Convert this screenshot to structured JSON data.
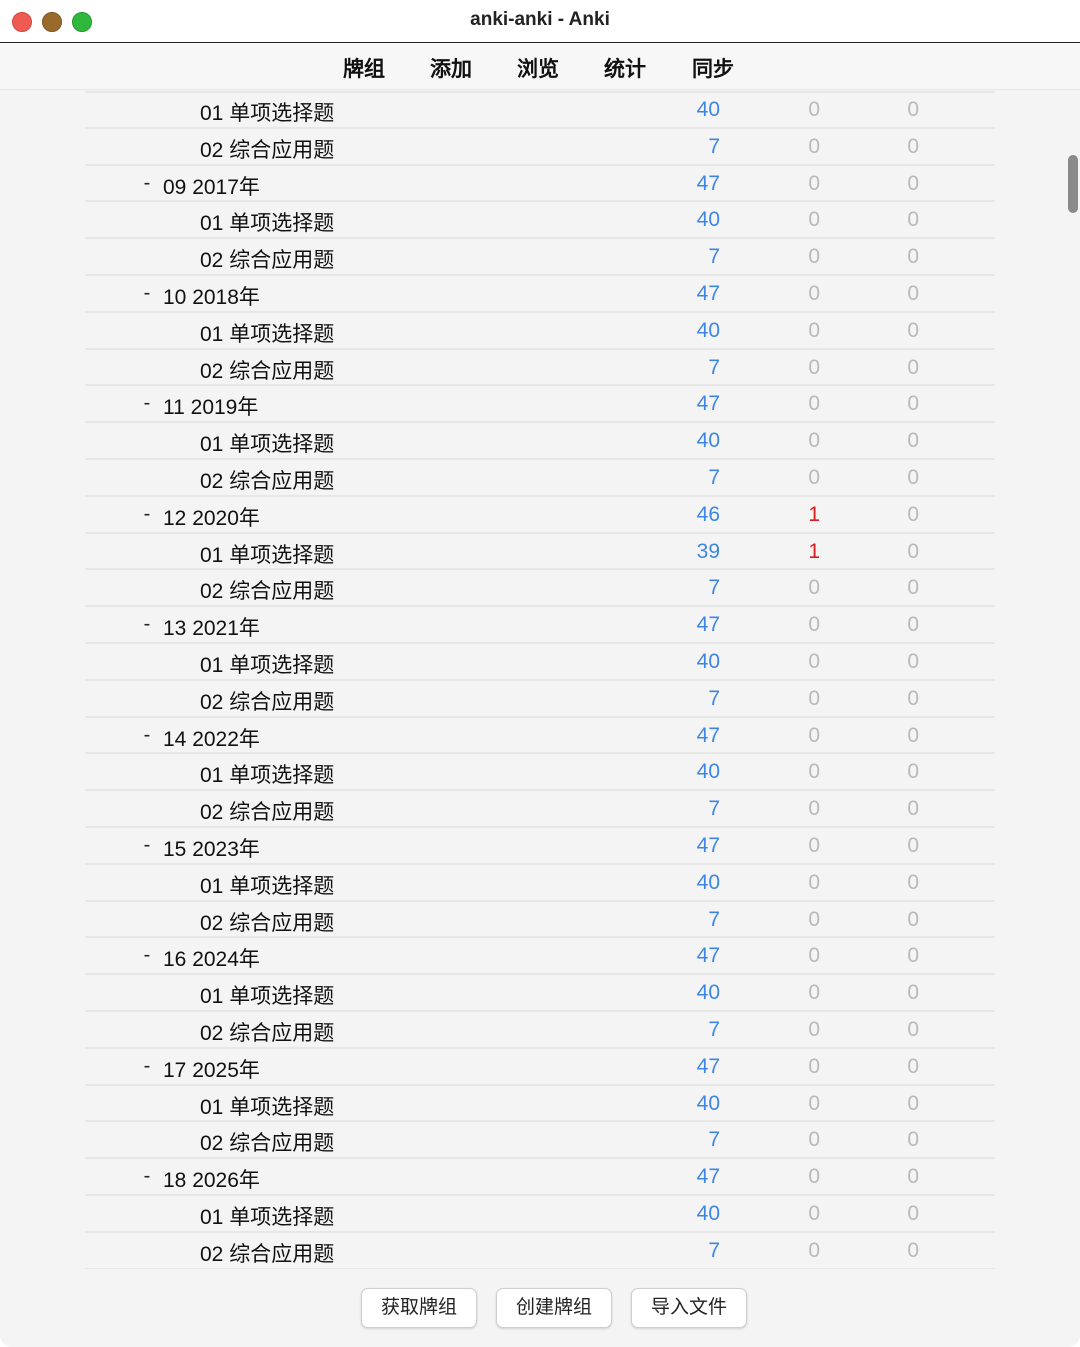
{
  "window": {
    "title": "anki-anki - Anki"
  },
  "toolbar": {
    "items": [
      "牌组",
      "添加",
      "浏览",
      "统计",
      "同步"
    ]
  },
  "colors": {
    "due": "#3e86e3",
    "learn_active": "#d91c1c",
    "zero": "#b9b9b9"
  },
  "decks": [
    {
      "level": "child",
      "collapse": "",
      "name": "01 单项选择题",
      "due": "40",
      "learn": "0",
      "new": "0"
    },
    {
      "level": "child",
      "collapse": "",
      "name": "02 综合应用题",
      "due": "7",
      "learn": "0",
      "new": "0"
    },
    {
      "level": "parent",
      "collapse": "-",
      "name": "09 2017年",
      "due": "47",
      "learn": "0",
      "new": "0"
    },
    {
      "level": "child",
      "collapse": "",
      "name": "01 单项选择题",
      "due": "40",
      "learn": "0",
      "new": "0"
    },
    {
      "level": "child",
      "collapse": "",
      "name": "02 综合应用题",
      "due": "7",
      "learn": "0",
      "new": "0"
    },
    {
      "level": "parent",
      "collapse": "-",
      "name": "10 2018年",
      "due": "47",
      "learn": "0",
      "new": "0"
    },
    {
      "level": "child",
      "collapse": "",
      "name": "01 单项选择题",
      "due": "40",
      "learn": "0",
      "new": "0"
    },
    {
      "level": "child",
      "collapse": "",
      "name": "02 综合应用题",
      "due": "7",
      "learn": "0",
      "new": "0"
    },
    {
      "level": "parent",
      "collapse": "-",
      "name": "11 2019年",
      "due": "47",
      "learn": "0",
      "new": "0"
    },
    {
      "level": "child",
      "collapse": "",
      "name": "01 单项选择题",
      "due": "40",
      "learn": "0",
      "new": "0"
    },
    {
      "level": "child",
      "collapse": "",
      "name": "02 综合应用题",
      "due": "7",
      "learn": "0",
      "new": "0"
    },
    {
      "level": "parent",
      "collapse": "-",
      "name": "12 2020年",
      "due": "46",
      "learn": "1",
      "new": "0"
    },
    {
      "level": "child",
      "collapse": "",
      "name": "01 单项选择题",
      "due": "39",
      "learn": "1",
      "new": "0"
    },
    {
      "level": "child",
      "collapse": "",
      "name": "02 综合应用题",
      "due": "7",
      "learn": "0",
      "new": "0"
    },
    {
      "level": "parent",
      "collapse": "-",
      "name": "13 2021年",
      "due": "47",
      "learn": "0",
      "new": "0"
    },
    {
      "level": "child",
      "collapse": "",
      "name": "01 单项选择题",
      "due": "40",
      "learn": "0",
      "new": "0"
    },
    {
      "level": "child",
      "collapse": "",
      "name": "02 综合应用题",
      "due": "7",
      "learn": "0",
      "new": "0"
    },
    {
      "level": "parent",
      "collapse": "-",
      "name": "14 2022年",
      "due": "47",
      "learn": "0",
      "new": "0"
    },
    {
      "level": "child",
      "collapse": "",
      "name": "01 单项选择题",
      "due": "40",
      "learn": "0",
      "new": "0"
    },
    {
      "level": "child",
      "collapse": "",
      "name": "02 综合应用题",
      "due": "7",
      "learn": "0",
      "new": "0"
    },
    {
      "level": "parent",
      "collapse": "-",
      "name": "15 2023年",
      "due": "47",
      "learn": "0",
      "new": "0"
    },
    {
      "level": "child",
      "collapse": "",
      "name": "01 单项选择题",
      "due": "40",
      "learn": "0",
      "new": "0"
    },
    {
      "level": "child",
      "collapse": "",
      "name": "02 综合应用题",
      "due": "7",
      "learn": "0",
      "new": "0"
    },
    {
      "level": "parent",
      "collapse": "-",
      "name": "16 2024年",
      "due": "47",
      "learn": "0",
      "new": "0"
    },
    {
      "level": "child",
      "collapse": "",
      "name": "01 单项选择题",
      "due": "40",
      "learn": "0",
      "new": "0"
    },
    {
      "level": "child",
      "collapse": "",
      "name": "02 综合应用题",
      "due": "7",
      "learn": "0",
      "new": "0"
    },
    {
      "level": "parent",
      "collapse": "-",
      "name": "17 2025年",
      "due": "47",
      "learn": "0",
      "new": "0"
    },
    {
      "level": "child",
      "collapse": "",
      "name": "01 单项选择题",
      "due": "40",
      "learn": "0",
      "new": "0"
    },
    {
      "level": "child",
      "collapse": "",
      "name": "02 综合应用题",
      "due": "7",
      "learn": "0",
      "new": "0"
    },
    {
      "level": "parent",
      "collapse": "-",
      "name": "18 2026年",
      "due": "47",
      "learn": "0",
      "new": "0"
    },
    {
      "level": "child",
      "collapse": "",
      "name": "01 单项选择题",
      "due": "40",
      "learn": "0",
      "new": "0"
    },
    {
      "level": "child",
      "collapse": "",
      "name": "02 综合应用题",
      "due": "7",
      "learn": "0",
      "new": "0"
    }
  ],
  "buttons": {
    "get_shared": "获取牌组",
    "create_deck": "创建牌组",
    "import_file": "导入文件"
  }
}
